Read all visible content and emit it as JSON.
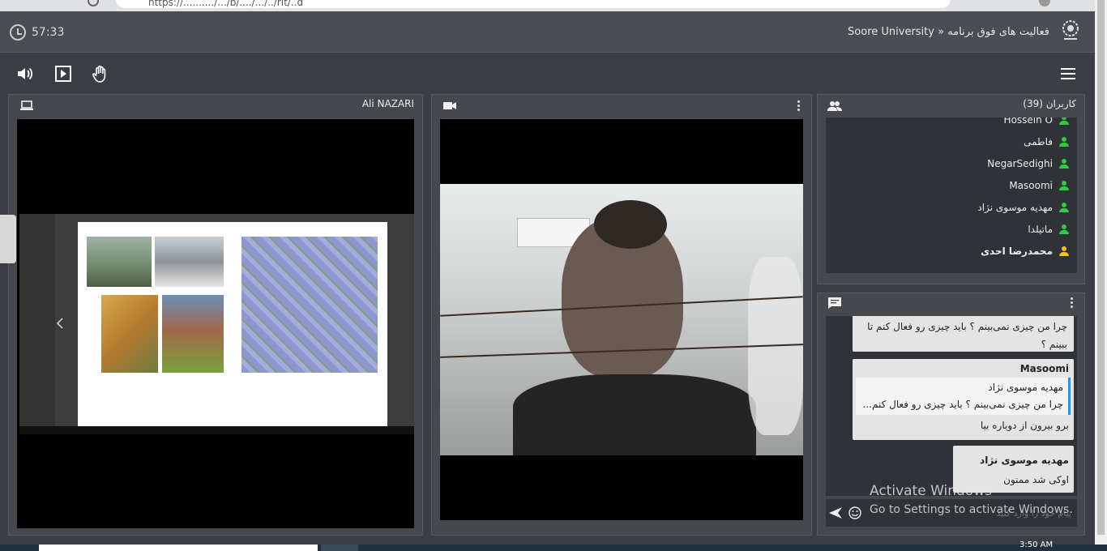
{
  "browser": {
    "url": "https://........../.../b/..../.../../rlt/..d"
  },
  "header": {
    "timer": "57:33",
    "title": "Soore University » فعالیت های فوق برنامه",
    "logo_icon": "university-seal-icon"
  },
  "toolbar": {
    "audio_icon": "speaker-icon",
    "presentation_icon": "play-presentation-icon",
    "raise_hand_icon": "hand-icon",
    "menu_icon": "hamburger-menu-icon"
  },
  "screenshare": {
    "presenter_name": "Ali NAZARI",
    "icon": "laptop-icon"
  },
  "webcam": {
    "icon": "video-camera-icon",
    "options_icon": "more-vertical-icon"
  },
  "users": {
    "header": "کاربران (39)",
    "icon": "people-icon",
    "items": [
      {
        "name": "Hossein O",
        "color": "#2ecc40"
      },
      {
        "name": "فاطمی",
        "color": "#2ecc40"
      },
      {
        "name": "NegarSedighi",
        "color": "#2ecc40"
      },
      {
        "name": "Masoomi",
        "color": "#2ecc40"
      },
      {
        "name": "مهدیه موسوی نژاد",
        "color": "#2ecc40"
      },
      {
        "name": "ماتیلدا",
        "color": "#2ecc40"
      },
      {
        "name": "محمدرضا احدی",
        "color": "#f1c40f",
        "bold": true
      }
    ]
  },
  "chat": {
    "icon": "chat-bubble-icon",
    "options_icon": "more-vertical-icon",
    "messages": [
      {
        "text": "چرا من چیزی نمی‌بینم ؟ باید چیزی رو فعال کنم تا ببینم ؟"
      },
      {
        "sender": "Masoomi",
        "quote_author": "مهدیه موسوی نژاد",
        "quote_text": "چرا من چیزی نمی‌بینم ؟ باید چیزی رو فعال کنم...",
        "text": "برو بیرون از دوباره بیا"
      },
      {
        "sender": "مهدیه موسوی نژاد",
        "text": "اوکی شد ممنون"
      }
    ],
    "input_placeholder": "پیام خود را وارد کنید",
    "send_icon": "send-icon",
    "emoji_icon": "smiley-icon"
  },
  "watermark": {
    "line1": "Activate Windows",
    "line2": "Go to Settings to activate Windows."
  },
  "taskbar": {
    "clock": "3:50 AM"
  }
}
